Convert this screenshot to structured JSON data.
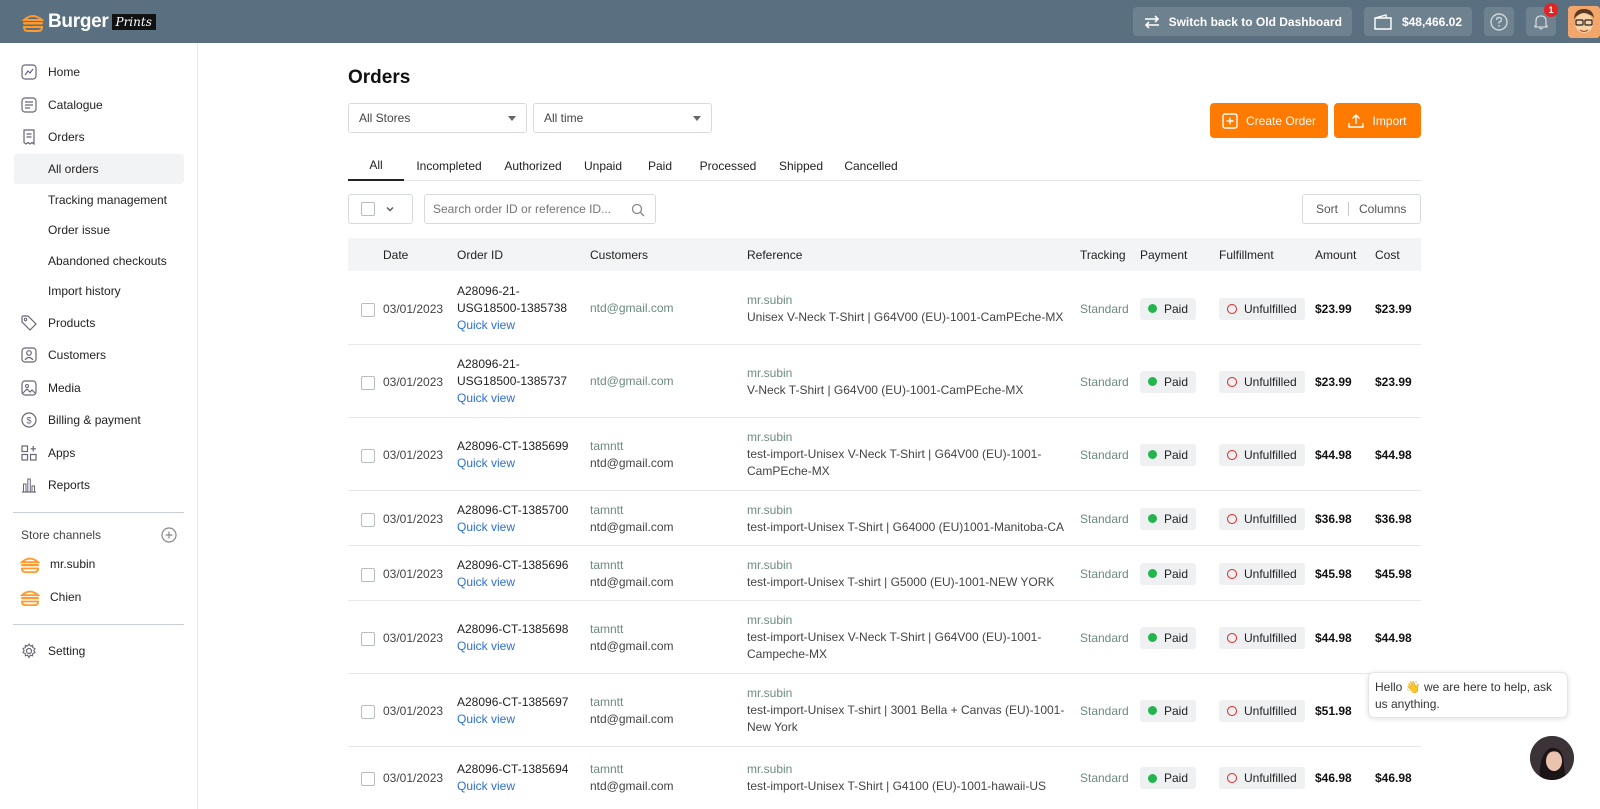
{
  "brand": {
    "name": "Burger",
    "sub": "Prints"
  },
  "topbar": {
    "switch_label": "Switch back to Old Dashboard",
    "balance": "$48,466.02",
    "notification_count": "1"
  },
  "sidebar": {
    "items": [
      {
        "label": "Home"
      },
      {
        "label": "Catalogue"
      },
      {
        "label": "Orders"
      }
    ],
    "orders_sub": [
      {
        "label": "All orders"
      },
      {
        "label": "Tracking management"
      },
      {
        "label": "Order issue"
      },
      {
        "label": "Abandoned checkouts"
      },
      {
        "label": "Import history"
      }
    ],
    "items2": [
      {
        "label": "Products"
      },
      {
        "label": "Customers"
      },
      {
        "label": "Media"
      },
      {
        "label": "Billing & payment"
      },
      {
        "label": "Apps"
      },
      {
        "label": "Reports"
      }
    ],
    "store_channels_label": "Store channels",
    "stores": [
      {
        "label": "mr.subin"
      },
      {
        "label": "Chien"
      }
    ],
    "setting": "Setting"
  },
  "main": {
    "title": "Orders",
    "store_filter": "All Stores",
    "time_filter": "All time",
    "create_order": "Create Order",
    "import": "Import",
    "tabs": [
      "All",
      "Incompleted",
      "Authorized",
      "Unpaid",
      "Paid",
      "Processed",
      "Shipped",
      "Cancelled"
    ],
    "search_placeholder": "Search order ID or reference ID...",
    "sort": "Sort",
    "columns": "Columns"
  },
  "table": {
    "headers": {
      "date": "Date",
      "order_id": "Order ID",
      "customers": "Customers",
      "reference": "Reference",
      "tracking": "Tracking",
      "payment": "Payment",
      "fulfillment": "Fulfillment",
      "amount": "Amount",
      "cost": "Cost"
    },
    "quick_view": "Quick view",
    "rows": [
      {
        "date": "03/01/2023",
        "id1": "A28096-21-",
        "id2": "USG18500-1385738",
        "cust1": "",
        "cust2": "ntd@gmail.com",
        "store": "mr.subin",
        "ref1": "Unisex V-Neck T-Shirt | G64V00 (EU)-1001-CamPEche-MX",
        "ref2": "",
        "tracking": "Standard",
        "payment": "Paid",
        "fulfillment": "Unfulfilled",
        "amount": "$23.99",
        "cost": "$23.99"
      },
      {
        "date": "03/01/2023",
        "id1": "A28096-21-",
        "id2": "USG18500-1385737",
        "cust1": "",
        "cust2": "ntd@gmail.com",
        "store": "mr.subin",
        "ref1": "V-Neck T-Shirt | G64V00 (EU)-1001-CamPEche-MX",
        "ref2": "",
        "tracking": "Standard",
        "payment": "Paid",
        "fulfillment": "Unfulfilled",
        "amount": "$23.99",
        "cost": "$23.99"
      },
      {
        "date": "03/01/2023",
        "id1": "A28096-CT-1385699",
        "id2": "",
        "cust1": "tamntt",
        "cust2": "ntd@gmail.com",
        "store": "mr.subin",
        "ref1": "test-import-Unisex V-Neck T-Shirt | G64V00 (EU)-1001-",
        "ref2": "CamPEche-MX",
        "tracking": "Standard",
        "payment": "Paid",
        "fulfillment": "Unfulfilled",
        "amount": "$44.98",
        "cost": "$44.98"
      },
      {
        "date": "03/01/2023",
        "id1": "A28096-CT-1385700",
        "id2": "",
        "cust1": "tamntt",
        "cust2": "ntd@gmail.com",
        "store": "mr.subin",
        "ref1": "test-import-Unisex T-Shirt | G64000 (EU)1001-Manitoba-CA",
        "ref2": "",
        "tracking": "Standard",
        "payment": "Paid",
        "fulfillment": "Unfulfilled",
        "amount": "$36.98",
        "cost": "$36.98"
      },
      {
        "date": "03/01/2023",
        "id1": "A28096-CT-1385696",
        "id2": "",
        "cust1": "tamntt",
        "cust2": "ntd@gmail.com",
        "store": "mr.subin",
        "ref1": "test-import-Unisex T-shirt | G5000 (EU)-1001-NEW YORK",
        "ref2": "",
        "tracking": "Standard",
        "payment": "Paid",
        "fulfillment": "Unfulfilled",
        "amount": "$45.98",
        "cost": "$45.98"
      },
      {
        "date": "03/01/2023",
        "id1": "A28096-CT-1385698",
        "id2": "",
        "cust1": "tamntt",
        "cust2": "ntd@gmail.com",
        "store": "mr.subin",
        "ref1": "test-import-Unisex V-Neck T-Shirt | G64V00 (EU)-1001-",
        "ref2": "Campeche-MX",
        "tracking": "Standard",
        "payment": "Paid",
        "fulfillment": "Unfulfilled",
        "amount": "$44.98",
        "cost": "$44.98"
      },
      {
        "date": "03/01/2023",
        "id1": "A28096-CT-1385697",
        "id2": "",
        "cust1": "tamntt",
        "cust2": "ntd@gmail.com",
        "store": "mr.subin",
        "ref1": "test-import-Unisex T-shirt | 3001 Bella + Canvas (EU)-1001-",
        "ref2": "New York",
        "tracking": "Standard",
        "payment": "Paid",
        "fulfillment": "Unfulfilled",
        "amount": "$51.98",
        "cost": ""
      },
      {
        "date": "03/01/2023",
        "id1": "A28096-CT-1385694",
        "id2": "",
        "cust1": "tamntt",
        "cust2": "ntd@gmail.com",
        "store": "mr.subin",
        "ref1": "test-import-Unisex T-Shirt | G4100 (EU)-1001-hawaii-US",
        "ref2": "",
        "tracking": "Standard",
        "payment": "Paid",
        "fulfillment": "Unfulfilled",
        "amount": "$46.98",
        "cost": "$46.98"
      }
    ]
  },
  "chat": {
    "text": "Hello 👋 we are here to help, ask us anything."
  }
}
